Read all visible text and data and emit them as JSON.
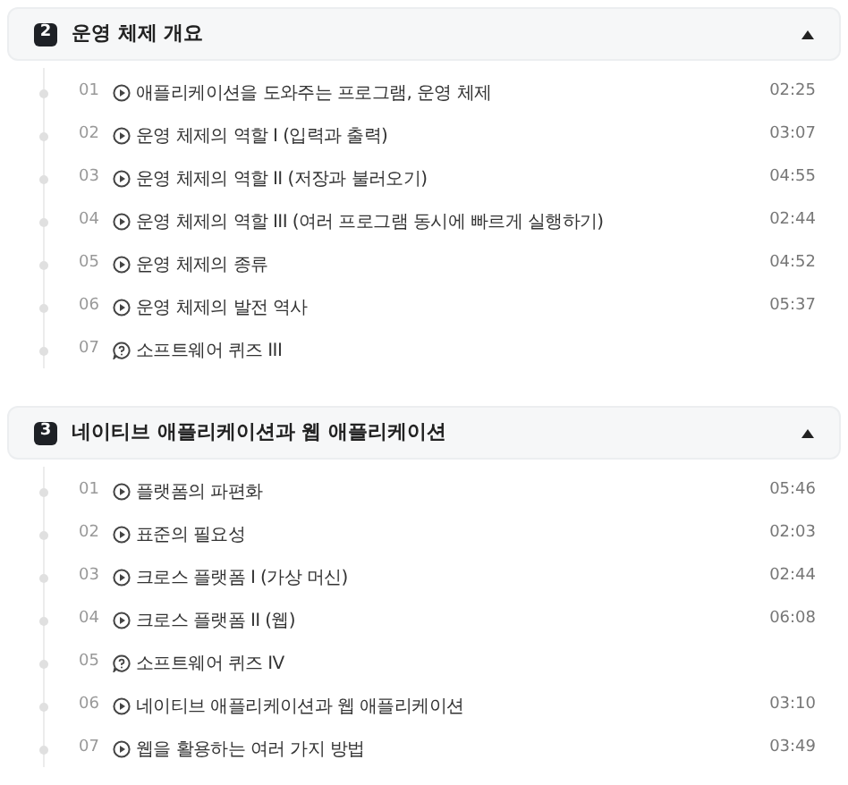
{
  "sections": [
    {
      "number": "2",
      "title": "운영 체제 개요",
      "expanded": true,
      "lessons": [
        {
          "index": "01",
          "kind": "video",
          "title": "애플리케이션을 도와주는 프로그램, 운영 체제",
          "duration": "02:25"
        },
        {
          "index": "02",
          "kind": "video",
          "title": "운영 체제의 역할 I (입력과 출력)",
          "duration": "03:07"
        },
        {
          "index": "03",
          "kind": "video",
          "title": "운영 체제의 역할 II (저장과 불러오기)",
          "duration": "04:55"
        },
        {
          "index": "04",
          "kind": "video",
          "title": "운영 체제의 역할 III (여러 프로그램 동시에 빠르게 실행하기)",
          "duration": "02:44"
        },
        {
          "index": "05",
          "kind": "video",
          "title": "운영 체제의 종류",
          "duration": "04:52"
        },
        {
          "index": "06",
          "kind": "video",
          "title": "운영 체제의 발전 역사",
          "duration": "05:37"
        },
        {
          "index": "07",
          "kind": "quiz",
          "title": "소프트웨어 퀴즈 III"
        }
      ]
    },
    {
      "number": "3",
      "title": "네이티브 애플리케이션과 웹 애플리케이션",
      "expanded": true,
      "lessons": [
        {
          "index": "01",
          "kind": "video",
          "title": "플랫폼의 파편화",
          "duration": "05:46"
        },
        {
          "index": "02",
          "kind": "video",
          "title": "표준의 필요성",
          "duration": "02:03"
        },
        {
          "index": "03",
          "kind": "video",
          "title": "크로스 플랫폼 I (가상 머신)",
          "duration": "02:44"
        },
        {
          "index": "04",
          "kind": "video",
          "title": "크로스 플랫폼 II (웹)",
          "duration": "06:08"
        },
        {
          "index": "05",
          "kind": "quiz",
          "title": "소프트웨어 퀴즈 IV"
        },
        {
          "index": "06",
          "kind": "video",
          "title": "네이티브 애플리케이션과 웹 애플리케이션",
          "duration": "03:10"
        },
        {
          "index": "07",
          "kind": "video",
          "title": "웹을 활용하는 여러 가지 방법",
          "duration": "03:49"
        }
      ]
    }
  ]
}
